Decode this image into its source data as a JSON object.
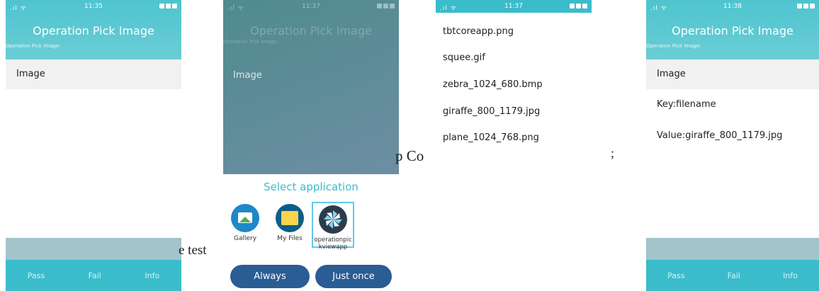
{
  "screen1": {
    "status_time": "11:35",
    "title": "Operation Pick Image",
    "subtitle": "Operation Pick Image:",
    "row_label": "Image",
    "tabs": [
      "Pass",
      "Fail",
      "Info"
    ]
  },
  "overlay_text1": "e test",
  "screen2": {
    "status_time": "11:37",
    "title": "Operation Pick Image",
    "subtitle": "Operation Pick Image:",
    "row_label": "Image",
    "dialog_title": "Select application",
    "apps": [
      "Gallery",
      "My Files",
      "operationpic kviewapp"
    ],
    "always_label": "Always",
    "just_once_label": "Just once"
  },
  "overlay_text2": "p Co",
  "overlay_text3": ";",
  "screen3": {
    "status_time": "11:37",
    "files": [
      "tbtcoreapp.png",
      "squee.gif",
      "zebra_1024_680.bmp",
      "giraffe_800_1179.jpg",
      "plane_1024_768.png"
    ]
  },
  "screen4": {
    "status_time": "11:38",
    "title": "Operation Pick Image",
    "subtitle": "Operation Pick Image:",
    "rows": [
      "Image",
      "Key:filename",
      "Value:giraffe_800_1179.jpg"
    ],
    "tabs": [
      "Pass",
      "Fail",
      "Info"
    ]
  },
  "colors": {
    "accent": "#3bbccb",
    "dialog_button": "#2a5d93",
    "dialog_title": "#3bbccb"
  },
  "icons": [
    "signal-icon",
    "wifi-icon",
    "battery-icon",
    "gallery-icon",
    "folder-icon",
    "app-icon"
  ]
}
